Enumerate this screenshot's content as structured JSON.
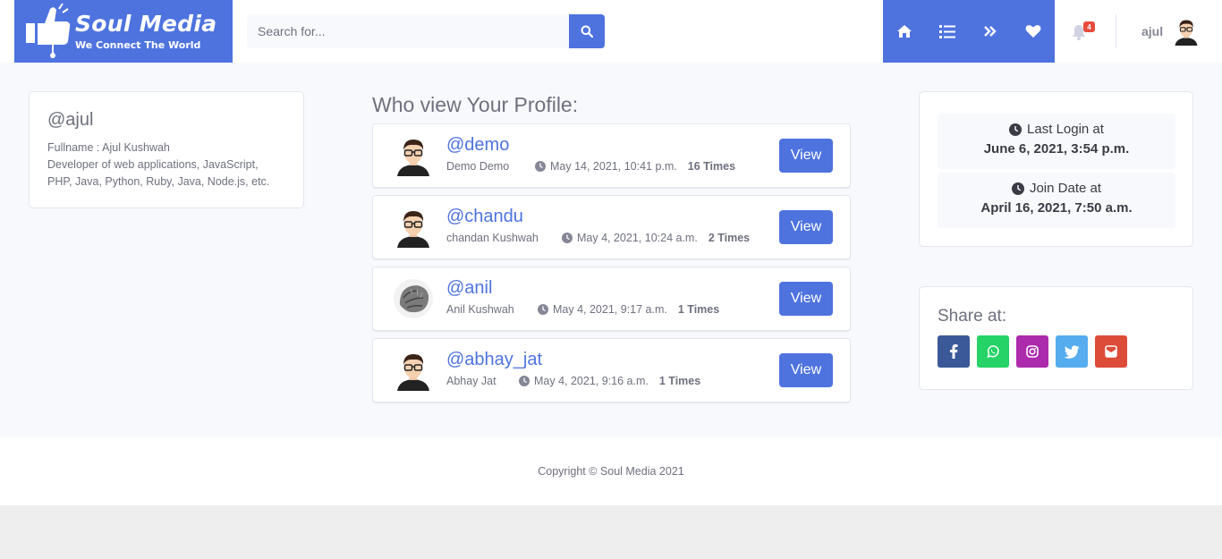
{
  "brand": {
    "name": "Soul Media",
    "tagline": "We Connect The World",
    "color": "#4e73df"
  },
  "search": {
    "placeholder": "Search for..."
  },
  "nav": {
    "icons": [
      "home-icon",
      "list-icon",
      "double-chevron-right-icon",
      "heart-icon"
    ]
  },
  "notifications": {
    "count": "4"
  },
  "user": {
    "name": "ajul"
  },
  "profile": {
    "handle": "@ajul",
    "fullname": "Fullname : Ajul Kushwah",
    "bio_line1": "Developer of web applications, JavaScript,",
    "bio_line2": "PHP, Java, Python, Ruby, Java, Node.js, etc."
  },
  "views": {
    "title": "Who view Your Profile:",
    "items": [
      {
        "handle": "@demo",
        "name": "Demo Demo",
        "time": "May 14, 2021, 10:41 p.m.",
        "count": "16 Times",
        "button": "View"
      },
      {
        "handle": "@chandu",
        "name": "chandan Kushwah",
        "time": "May 4, 2021, 10:24 a.m.",
        "count": "2 Times",
        "button": "View"
      },
      {
        "handle": "@anil",
        "name": "Anil Kushwah",
        "time": "May 4, 2021, 9:17 a.m.",
        "count": "1 Times",
        "button": "View"
      },
      {
        "handle": "@abhay_jat",
        "name": "Abhay Jat",
        "time": "May 4, 2021, 9:16 a.m.",
        "count": "1 Times",
        "button": "View"
      }
    ]
  },
  "stats": {
    "last_login_label": "Last Login at",
    "last_login_value": "June 6, 2021, 3:54 p.m.",
    "join_label": "Join Date at",
    "join_value": "April 16, 2021, 7:50 a.m."
  },
  "share": {
    "title": "Share at:",
    "buttons": [
      {
        "icon": "facebook-icon",
        "color": "#3b5998"
      },
      {
        "icon": "whatsapp-icon",
        "color": "#25d366"
      },
      {
        "icon": "instagram-icon",
        "color": "#ac2bac"
      },
      {
        "icon": "twitter-icon",
        "color": "#55acee"
      },
      {
        "icon": "email-icon",
        "color": "#dd4b39"
      }
    ]
  },
  "footer": {
    "copyright": "Copyright © Soul Media 2021"
  }
}
